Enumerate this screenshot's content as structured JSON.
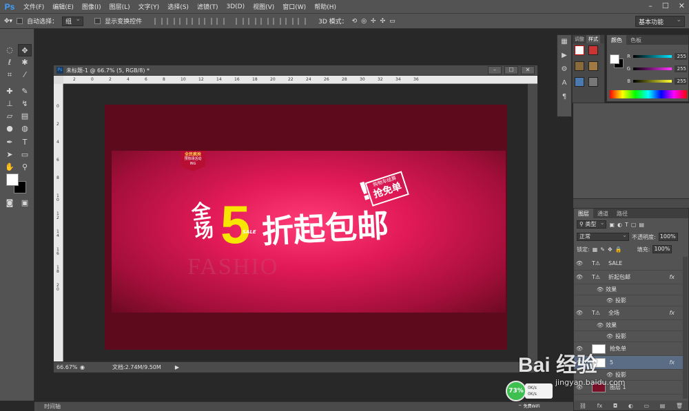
{
  "app": {
    "logo": "Ps"
  },
  "menu": [
    "文件(F)",
    "编辑(E)",
    "图像(I)",
    "图层(L)",
    "文字(Y)",
    "选择(S)",
    "滤镜(T)",
    "3D(D)",
    "视图(V)",
    "窗口(W)",
    "帮助(H)"
  ],
  "options_bar": {
    "auto_select_label": "自动选择：",
    "auto_select_value": "组",
    "show_transform_label": "显示变换控件",
    "mode_3d_label": "3D 模式：",
    "workspace": "基本功能"
  },
  "document": {
    "title": "未标题-1 @ 66.7% (5, RGB/8) *",
    "zoom": "66.67%",
    "doc_info": "文档:2.74M/9.50M",
    "ruler_h": [
      "2",
      "0",
      "2",
      "4",
      "6",
      "8",
      "10",
      "12",
      "14",
      "16",
      "18",
      "20",
      "22",
      "24",
      "26",
      "28",
      "30",
      "32",
      "34",
      "36"
    ],
    "ruler_v": [
      "0",
      "2",
      "4",
      "6",
      "8",
      "1 0",
      "1 2",
      "1 4",
      "1 6",
      "1 8",
      "2 0"
    ]
  },
  "artwork": {
    "tag_line1": "全民疯抢",
    "tag_line2": "预热场活动",
    "tag_line3": "ING",
    "quan_chang": "全场",
    "five": "5",
    "sale_tiny": "SALE",
    "main_text": "折起包邮",
    "stamp_top": "购物车结算",
    "stamp_main": "抢免单",
    "stamp_bang": "!",
    "fashion": "FASHIO"
  },
  "right_strip": {
    "tab_adjust": "调整",
    "tab_style": "样式"
  },
  "color_panel": {
    "tabs": [
      "颜色",
      "色板"
    ],
    "r_label": "R",
    "g_label": "G",
    "b_label": "B",
    "r_value": "255",
    "g_value": "255",
    "b_value": "255",
    "colors": {
      "r_bar": "#00e5ff",
      "g_bar": "#ff33ff",
      "b_bar": "#ffff33"
    }
  },
  "layers_panel": {
    "tabs": [
      "图层",
      "通道",
      "路径"
    ],
    "kind_filter": "类型",
    "blend_mode": "正常",
    "opacity_label": "不透明度:",
    "opacity_value": "100%",
    "lock_label": "锁定:",
    "fill_label": "填充:",
    "fill_value": "100%",
    "layers": [
      {
        "name": "SALE",
        "type": "text",
        "fx": ""
      },
      {
        "name": "折起包邮",
        "type": "text",
        "fx": "fx"
      },
      {
        "name": "效果",
        "type": "effects"
      },
      {
        "name": "投影",
        "type": "effect"
      },
      {
        "name": "全场",
        "type": "text",
        "fx": "fx"
      },
      {
        "name": "效果",
        "type": "effects"
      },
      {
        "name": "投影",
        "type": "effect"
      },
      {
        "name": "抢免单",
        "type": "image",
        "fx": ""
      },
      {
        "name": "5",
        "type": "image",
        "fx": "fx",
        "selected": true
      },
      {
        "name": "投影",
        "type": "effect"
      },
      {
        "name": "图层 1",
        "type": "image",
        "fx": ""
      }
    ]
  },
  "timeline": {
    "label": "时间轴"
  },
  "net_widget": {
    "percent": "73%",
    "up": "0K/s",
    "down": "0K/s",
    "wifi": "免费WiFi"
  },
  "watermark": {
    "logo": "Bai 经验",
    "url": "jingyan.baidu.com"
  }
}
